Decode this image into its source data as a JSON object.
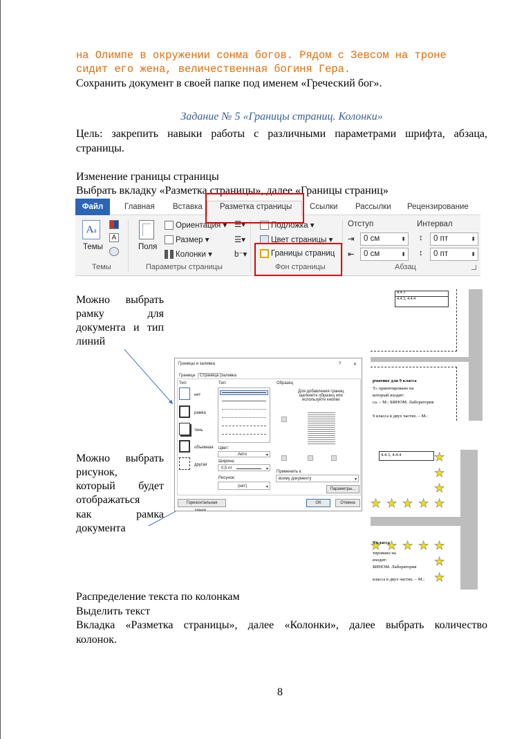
{
  "top_code_lines": [
    "на Олимпе в окружении сонма богов. Рядом с Зевсом на троне",
    "сидит его жена, величественная богиня Гера."
  ],
  "save_instruction": "Сохранить документ в своей папке под именем «Греческий бог».",
  "task_heading": "Задание № 5 «Границы страниц. Колонки»",
  "goal_line1": "Цель: закрепить навыки работы с различными параметрами шрифта, абзаца,",
  "goal_line2": "страницы.",
  "border_title": "Изменение границы страницы",
  "border_instruction": "Выбрать вкладку «Разметка страницы», далее «Границы страниц»",
  "ribbon": {
    "file_tab": "Файл",
    "tabs": [
      "Главная",
      "Вставка",
      "Разметка страницы",
      "Ссылки",
      "Рассылки",
      "Рецензирование"
    ],
    "themes_btn": "Темы",
    "themes_group": "Темы",
    "fields_btn": "Поля",
    "orientation": "Ориентация",
    "size": "Размер",
    "columns": "Колонки",
    "page_setup_group": "Параметры страницы",
    "watermark": "Подложка",
    "page_color": "Цвет страницы",
    "page_borders": "Границы страниц",
    "background_group": "Фон страницы",
    "indent_label": "Отступ",
    "spacing_label": "Интервал",
    "indent_left": "0 см",
    "indent_right": "0 см",
    "spacing_before": "0 пт",
    "spacing_after": "0 пт",
    "paragraph_group": "Абзац"
  },
  "side_note1": [
    "Можно выбрать",
    "рамку для",
    "документа и тип",
    "линий"
  ],
  "side_note2": [
    "Можно выбрать",
    "рисунок,",
    "который будет",
    "отображаться",
    "как рамка",
    "документа"
  ],
  "dialog": {
    "title": "Границы и заливка",
    "help": "?",
    "close": "✕",
    "tabs": [
      "Граница",
      "Страница",
      "Заливка"
    ],
    "type_label": "Тип:",
    "types": [
      "нет",
      "рамка",
      "тень",
      "объемная",
      "другая"
    ],
    "line_type_label": "Тип:",
    "color_label": "Цвет:",
    "color_value": "Авто",
    "width_label": "Ширина:",
    "width_value": "0,5 пт",
    "art_label": "Рисунок:",
    "art_value": "(нет)",
    "sample_label": "Образец",
    "sample_hint": [
      "Для добавления границ",
      "щелкните образец или",
      "используйте кнопки"
    ],
    "apply_label": "Применить к:",
    "apply_value": "всему документу",
    "options_btn": "Параметры...",
    "hline_btn": "Горизонтальная линия...",
    "ok_btn": "ОК",
    "cancel_btn": "Отмена"
  },
  "thumb1": {
    "cells": [
      "4.4.3",
      "4.4.3, 4.4.4"
    ],
    "lines": [
      "рматике для 9 класса",
      "Т» ориентировано на",
      "который входит:",
      "са. – М.: БИНОМ. Лаборатория",
      "9 класса в двух частях. – М.:"
    ]
  },
  "thumb2": {
    "cell": "4.4.3, 4.4.4",
    "lines": [
      "9 класса",
      "тировано на",
      "входит:",
      "БИНОМ. Лаборатория",
      "класса в двух частях. – М.:"
    ]
  },
  "columns_title": "Распределение текста по колонкам",
  "select_text": "Выделить текст",
  "columns_line1": "Вкладка «Разметка страницы», далее «Колонки», далее выбрать количество",
  "columns_line2": "колонок.",
  "page_number": "8"
}
